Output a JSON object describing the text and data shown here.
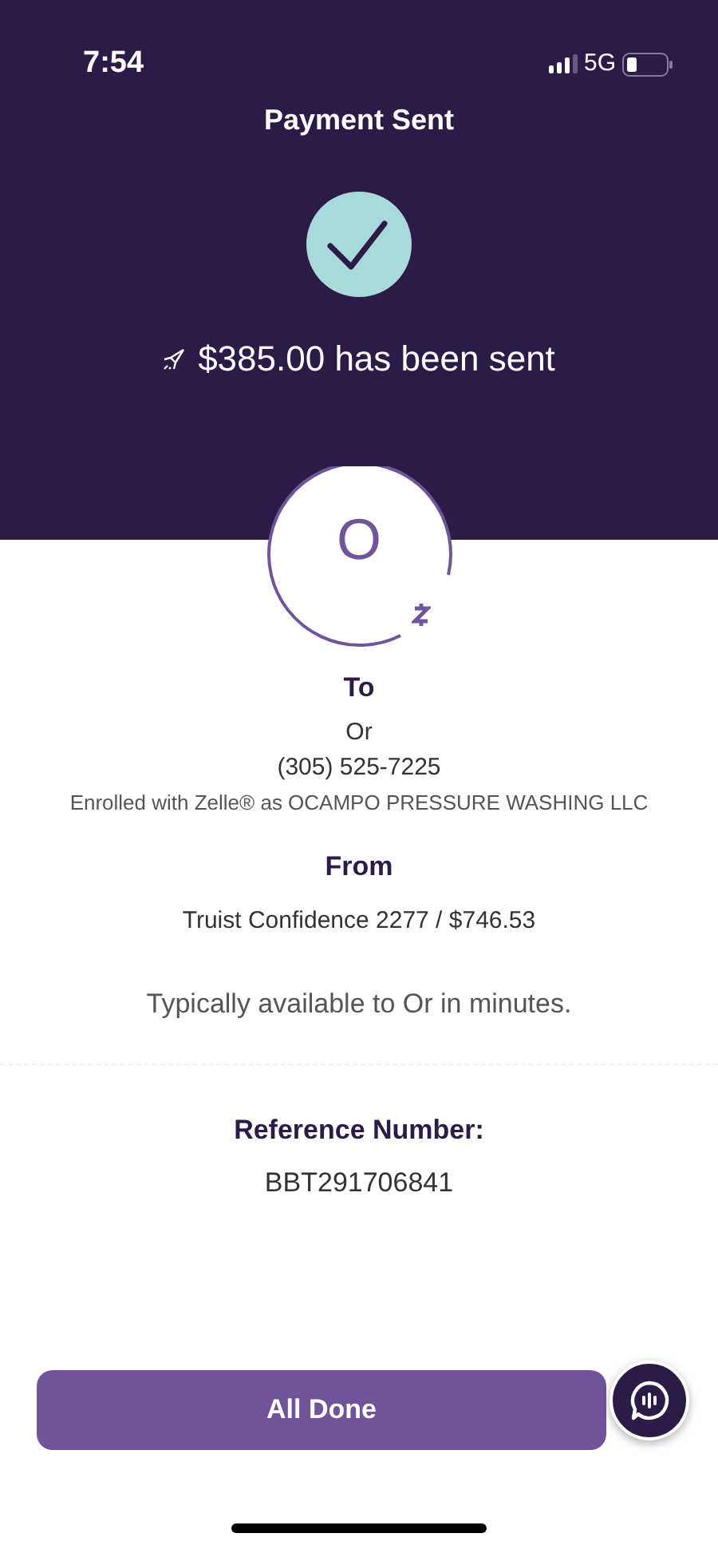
{
  "status_bar": {
    "time": "7:54",
    "network": "5G"
  },
  "header": {
    "title": "Payment Sent",
    "message": "$385.00 has been sent"
  },
  "recipient": {
    "initial": "O",
    "heading": "To",
    "name": "Or",
    "phone": "(305) 525-7225",
    "enrollment": "Enrolled with Zelle® as OCAMPO PRESSURE WASHING LLC"
  },
  "sender": {
    "heading": "From",
    "account": "Truist Confidence 2277 / $746.53"
  },
  "availability": "Typically available to Or in minutes.",
  "reference": {
    "heading": "Reference Number:",
    "number": "BBT291706841"
  },
  "button": {
    "label": "All Done"
  }
}
